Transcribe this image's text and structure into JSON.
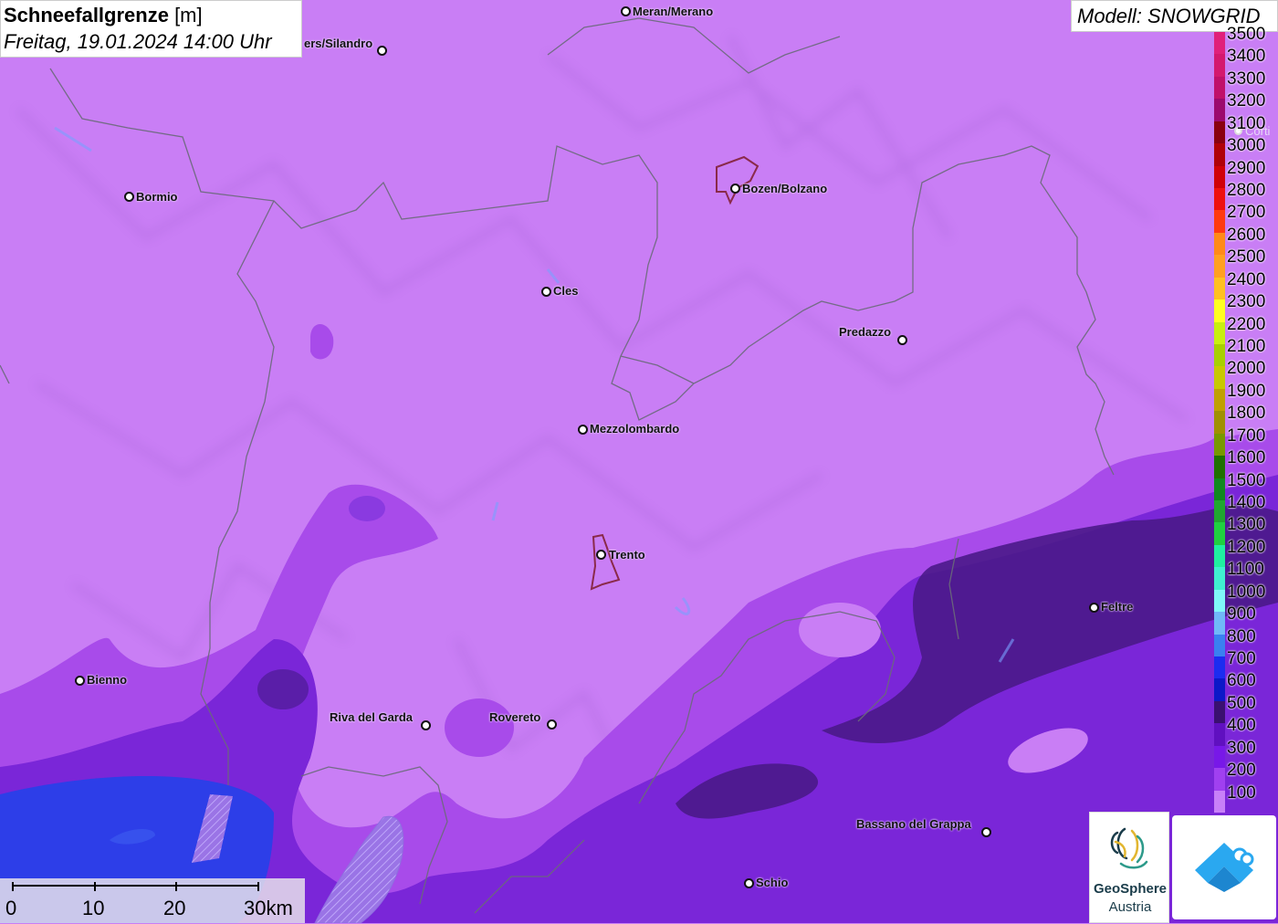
{
  "title": {
    "main_bold": "Schneefallgrenze",
    "main_unit": " [m]",
    "date": "Freitag, 19.01.2024 14:00 Uhr"
  },
  "model": "Modell: SNOWGRID",
  "cities": [
    {
      "name": "Meran/Merano"
    },
    {
      "name": "ers/Silandro"
    },
    {
      "name": "Bozen/Bolzano"
    },
    {
      "name": "Bormio"
    },
    {
      "name": "Cles"
    },
    {
      "name": "Predazzo"
    },
    {
      "name": "Mezzolombardo"
    },
    {
      "name": "Trento"
    },
    {
      "name": "Feltre"
    },
    {
      "name": "Bienno"
    },
    {
      "name": "Riva del Garda"
    },
    {
      "name": "Rovereto"
    },
    {
      "name": "Bassano del Grappa"
    },
    {
      "name": "Schio"
    },
    {
      "name": "Corti"
    }
  ],
  "legend": {
    "unit": "m",
    "entries": [
      {
        "value": "3500",
        "color": "#e0207a"
      },
      {
        "value": "3400",
        "color": "#d4186e"
      },
      {
        "value": "3300",
        "color": "#c0106a"
      },
      {
        "value": "3200",
        "color": "#9c0a6e"
      },
      {
        "value": "3100",
        "color": "#8a0010"
      },
      {
        "value": "3000",
        "color": "#b00008"
      },
      {
        "value": "2900",
        "color": "#d00008"
      },
      {
        "value": "2800",
        "color": "#ee1010"
      },
      {
        "value": "2700",
        "color": "#ff3a10"
      },
      {
        "value": "2600",
        "color": "#ff8a18"
      },
      {
        "value": "2500",
        "color": "#ffa020"
      },
      {
        "value": "2400",
        "color": "#ffc020"
      },
      {
        "value": "2300",
        "color": "#ffff20"
      },
      {
        "value": "2200",
        "color": "#c8f010"
      },
      {
        "value": "2100",
        "color": "#a8d000"
      },
      {
        "value": "2000",
        "color": "#c8c800"
      },
      {
        "value": "1900",
        "color": "#c0a000"
      },
      {
        "value": "1800",
        "color": "#a09000"
      },
      {
        "value": "1700",
        "color": "#789800"
      },
      {
        "value": "1600",
        "color": "#207000"
      },
      {
        "value": "1500",
        "color": "#108820"
      },
      {
        "value": "1400",
        "color": "#20a830"
      },
      {
        "value": "1300",
        "color": "#20d040"
      },
      {
        "value": "1200",
        "color": "#20f0a0"
      },
      {
        "value": "1100",
        "color": "#40f0d0"
      },
      {
        "value": "1000",
        "color": "#80f8f8"
      },
      {
        "value": "900",
        "color": "#70b8f8"
      },
      {
        "value": "800",
        "color": "#3a80f0"
      },
      {
        "value": "700",
        "color": "#1c2cf0"
      },
      {
        "value": "600",
        "color": "#0c18c8"
      },
      {
        "value": "500",
        "color": "#3a1070"
      },
      {
        "value": "400",
        "color": "#6010c0"
      },
      {
        "value": "300",
        "color": "#7818e8"
      },
      {
        "value": "200",
        "color": "#a040f0"
      },
      {
        "value": "100",
        "color": "#c880f8"
      }
    ]
  },
  "scale": {
    "labels": [
      "0",
      "10",
      "20",
      "30km"
    ]
  },
  "logos": {
    "geo_line1": "GeoSphere",
    "geo_line2": "Austria"
  },
  "colors": {
    "base": "#c97ef5",
    "band_mid": "#a84bea",
    "band_dark": "#7422d6",
    "deep": "#4a1a8a",
    "water": "#2d3ee8"
  }
}
